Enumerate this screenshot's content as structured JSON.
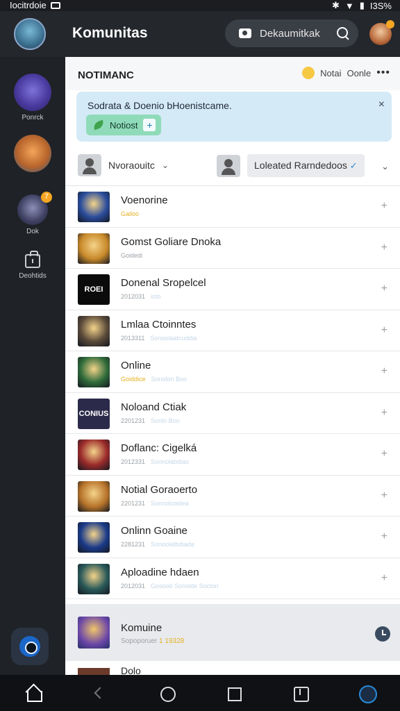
{
  "status_bar": {
    "left_text": "Iocitrdoie",
    "right_text": "I3S%"
  },
  "app_bar": {
    "title": "Komunitas",
    "search_text": "Dekaumitkak"
  },
  "sidebar": {
    "items": [
      {
        "label": "Ponrck"
      },
      {
        "label": ""
      },
      {
        "label": "Dok"
      },
      {
        "label": "Deohtids"
      }
    ],
    "avatar_badge": "7"
  },
  "main": {
    "heading": "NOTIMANC",
    "head_link_1": "Notai",
    "head_link_2": "Oonle",
    "notice": {
      "message": "Sodrata & Doenio bHoenistcame.",
      "pill_label": "Notiost",
      "close_glyph": "×"
    },
    "filter_1": {
      "label": "Nvoraouitc"
    },
    "filter_2": {
      "label": "Loleated Rarndedoos"
    }
  },
  "list": [
    {
      "name": "Voenorine",
      "sub": "Gailoo",
      "sub_extra": "",
      "highlight": true,
      "thumb_color": "#2a4c9c",
      "thumb_text": ""
    },
    {
      "name": "Gomst Goliare Dnoka",
      "sub": "Goidedi",
      "sub_extra": "",
      "highlight": false,
      "thumb_color": "#c98a2b",
      "thumb_text": ""
    },
    {
      "name": "Donenal Sropelcel",
      "sub": "2012031",
      "sub_extra": "ioto",
      "highlight": false,
      "thumb_color": "#0b0b0b",
      "thumb_text": "ROEI"
    },
    {
      "name": "Lmlaa Ctoinntes",
      "sub": "2013311",
      "sub_extra": "Sonoolaatcuddia",
      "highlight": false,
      "thumb_color": "#5a4a3a",
      "thumb_text": ""
    },
    {
      "name": "Online",
      "sub": "Goiddice",
      "sub_extra": "Sonidon Boo",
      "highlight": true,
      "thumb_color": "#2f6b3a",
      "thumb_text": ""
    },
    {
      "name": "Noloand Ctiak",
      "sub": "2201231",
      "sub_extra": "Sonlo Boo",
      "highlight": false,
      "thumb_color": "#2c2a4a",
      "thumb_text": "CONIUS"
    },
    {
      "name": "Doflanc: Cigelká",
      "sub": "2012331",
      "sub_extra": "Sonnolabdiao",
      "highlight": false,
      "thumb_color": "#9a2a2a",
      "thumb_text": ""
    },
    {
      "name": "Notial Goraoerto",
      "sub": "2201231",
      "sub_extra": "Sonnolcoidea",
      "highlight": false,
      "thumb_color": "#b8742b",
      "thumb_text": ""
    },
    {
      "name": "Onlinn Goaine",
      "sub": "2281231",
      "sub_extra": "Sonoolatbdiada",
      "highlight": false,
      "thumb_color": "#1a3a8a",
      "thumb_text": ""
    },
    {
      "name": "Aploadine hdaen",
      "sub": "2012031",
      "sub_extra": "Gosoob   Sonolde Socton",
      "highlight": false,
      "thumb_color": "#2a5a5a",
      "thumb_text": ""
    }
  ],
  "featured": {
    "name": "Komuine",
    "sub": "Sopoporuer",
    "sub_highlight": "1 19328"
  },
  "partial_row": {
    "name": "Dolo"
  },
  "icons": {
    "accent": "#2b8ad8",
    "badge": "#f5a623"
  }
}
